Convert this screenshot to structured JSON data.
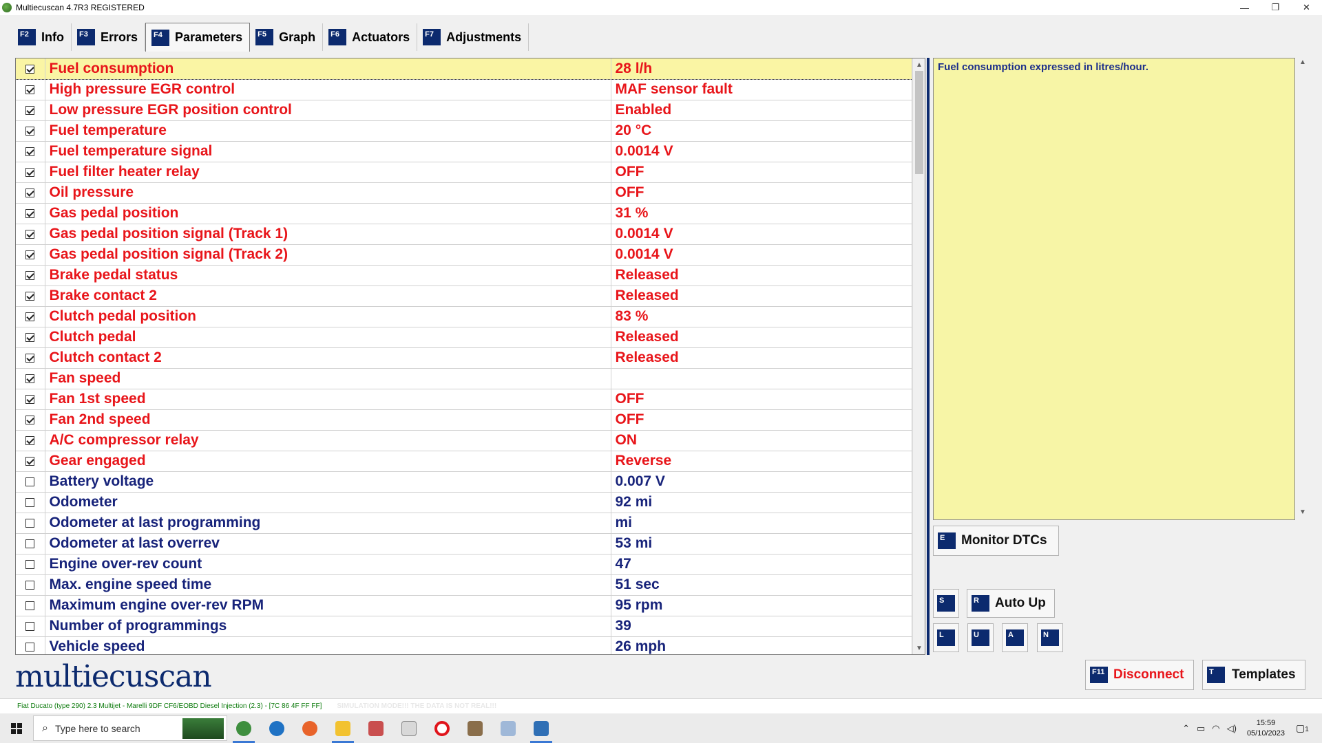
{
  "window": {
    "title": "Multiecuscan 4.7R3 REGISTERED",
    "controls": [
      "—",
      "❐",
      "✕"
    ]
  },
  "tabs": [
    {
      "key": "F2",
      "label": "Info",
      "active": false
    },
    {
      "key": "F3",
      "label": "Errors",
      "active": false
    },
    {
      "key": "F4",
      "label": "Parameters",
      "active": true
    },
    {
      "key": "F5",
      "label": "Graph",
      "active": false
    },
    {
      "key": "F6",
      "label": "Actuators",
      "active": false
    },
    {
      "key": "F7",
      "label": "Adjustments",
      "active": false
    }
  ],
  "parameters": [
    {
      "name": "Fuel consumption",
      "value": "28 l/h",
      "checked": true,
      "selected": true
    },
    {
      "name": "High pressure EGR control",
      "value": "MAF sensor fault",
      "checked": true
    },
    {
      "name": "Low pressure EGR position control",
      "value": "Enabled",
      "checked": true
    },
    {
      "name": "Fuel temperature",
      "value": "20 °C",
      "checked": true
    },
    {
      "name": "Fuel temperature signal",
      "value": "0.0014 V",
      "checked": true
    },
    {
      "name": "Fuel filter heater relay",
      "value": "OFF",
      "checked": true
    },
    {
      "name": "Oil pressure",
      "value": "OFF",
      "checked": true
    },
    {
      "name": "Gas pedal position",
      "value": "31 %",
      "checked": true
    },
    {
      "name": "Gas pedal position signal (Track 1)",
      "value": "0.0014 V",
      "checked": true
    },
    {
      "name": "Gas pedal position signal (Track 2)",
      "value": "0.0014 V",
      "checked": true
    },
    {
      "name": "Brake pedal status",
      "value": "Released",
      "checked": true
    },
    {
      "name": "Brake contact 2",
      "value": "Released",
      "checked": true
    },
    {
      "name": "Clutch pedal position",
      "value": "83 %",
      "checked": true
    },
    {
      "name": "Clutch pedal",
      "value": "Released",
      "checked": true
    },
    {
      "name": "Clutch contact 2",
      "value": "Released",
      "checked": true
    },
    {
      "name": "Fan speed",
      "value": "",
      "checked": true
    },
    {
      "name": "Fan 1st speed",
      "value": "OFF",
      "checked": true
    },
    {
      "name": "Fan 2nd speed",
      "value": "OFF",
      "checked": true
    },
    {
      "name": "A/C compressor relay",
      "value": "ON",
      "checked": true
    },
    {
      "name": "Gear engaged",
      "value": "Reverse",
      "checked": true
    },
    {
      "name": "Battery voltage",
      "value": "0.007 V",
      "checked": false
    },
    {
      "name": "Odometer",
      "value": "92 mi",
      "checked": false
    },
    {
      "name": "Odometer at last programming",
      "value": " mi",
      "checked": false
    },
    {
      "name": "Odometer at last overrev",
      "value": "53 mi",
      "checked": false
    },
    {
      "name": "Engine over-rev count",
      "value": "47",
      "checked": false
    },
    {
      "name": "Max. engine speed time",
      "value": "51 sec",
      "checked": false
    },
    {
      "name": "Maximum engine over-rev RPM",
      "value": "95 rpm",
      "checked": false
    },
    {
      "name": "Number of programmings",
      "value": "39",
      "checked": false
    },
    {
      "name": "Vehicle speed",
      "value": "26 mph",
      "checked": false
    }
  ],
  "description": {
    "text": "Fuel consumption expressed in litres/hour."
  },
  "buttons": {
    "monitor_dtcs": {
      "key": "E",
      "label": "Monitor DTCs"
    },
    "s": {
      "key": "S"
    },
    "auto_up": {
      "key": "R",
      "label": "Auto Up"
    },
    "l": {
      "key": "L"
    },
    "u": {
      "key": "U"
    },
    "a": {
      "key": "A"
    },
    "n": {
      "key": "N"
    },
    "disconnect": {
      "key": "F11",
      "label": "Disconnect"
    },
    "templates": {
      "key": "T",
      "label": "Templates"
    }
  },
  "logo": {
    "text": "multiecuscan"
  },
  "status": {
    "vehicle": "Fiat Ducato (type 290) 2.3 Multijet - Marelli 9DF CF6/EOBD Diesel Injection (2.3) - [7C 86 4F FF FF]",
    "simulation": "SIMULATION MODE!!! THE DATA IS NOT REAL!!!"
  },
  "taskbar": {
    "search_placeholder": "Type here to search",
    "time": "15:59",
    "date": "05/10/2023",
    "notification_count": "1"
  },
  "colors": {
    "checked_text": "#e8151a",
    "unchecked_text": "#17237a",
    "selected_row": "#faf5a4",
    "description_bg": "#f7f5a6",
    "key_badge": "#0c2a6e"
  }
}
